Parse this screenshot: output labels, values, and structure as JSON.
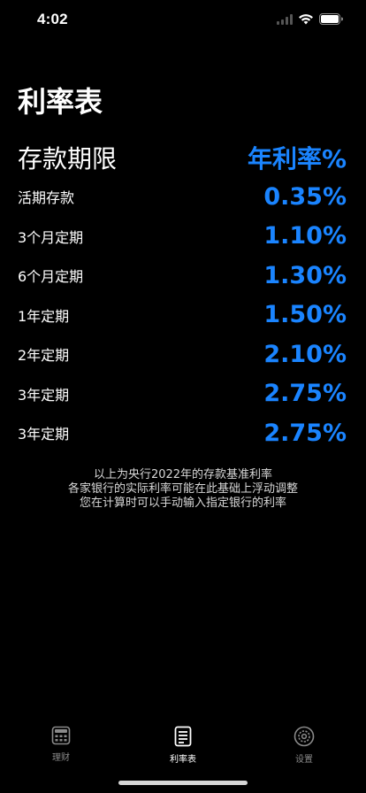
{
  "status_bar": {
    "time": "4:02"
  },
  "page": {
    "title": "利率表"
  },
  "table": {
    "header": {
      "term_label": "存款期限",
      "rate_label": "年利率%"
    },
    "rows": [
      {
        "term": "活期存款",
        "rate": "0.35%"
      },
      {
        "term": "3个月定期",
        "rate": "1.10%"
      },
      {
        "term": "6个月定期",
        "rate": "1.30%"
      },
      {
        "term": "1年定期",
        "rate": "1.50%"
      },
      {
        "term": "2年定期",
        "rate": "2.10%"
      },
      {
        "term": "3年定期",
        "rate": "2.75%"
      },
      {
        "term": "3年定期",
        "rate": "2.75%"
      }
    ]
  },
  "footnote": {
    "lines": [
      "以上为央行2022年的存款基准利率",
      "各家银行的实际利率可能在此基础上浮动调整",
      "您在计算时可以手动输入指定银行的利率"
    ]
  },
  "tab_bar": {
    "tabs": [
      {
        "label": "理财",
        "icon": "calculator-icon",
        "active": false
      },
      {
        "label": "利率表",
        "icon": "document-list-icon",
        "active": true
      },
      {
        "label": "设置",
        "icon": "gear-icon",
        "active": false
      }
    ]
  },
  "colors": {
    "background": "#000000",
    "accent": "#1a84ff",
    "text": "#ffffff",
    "tab_inactive": "#8a8a8a"
  }
}
